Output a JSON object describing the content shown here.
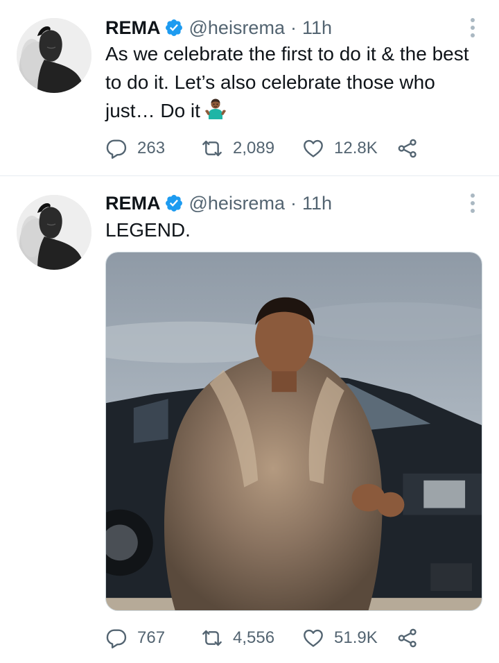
{
  "tweets": [
    {
      "author": {
        "name": "REMA",
        "handle": "@heisrema",
        "verified": true
      },
      "separator": "·",
      "time": "11h",
      "text": "As we celebrate the first to do it & the best to do it. Let’s also celebrate those who just… Do it",
      "emoji": "person-shrugging-emoji",
      "stats": {
        "replies": "263",
        "retweets": "2,089",
        "likes": "12.8K"
      },
      "has_media": false
    },
    {
      "author": {
        "name": "REMA",
        "handle": "@heisrema",
        "verified": true
      },
      "separator": "·",
      "time": "11h",
      "text": "LEGEND.",
      "stats": {
        "replies": "767",
        "retweets": "4,556",
        "likes": "51.9K"
      },
      "has_media": true,
      "media": {
        "description": "photo"
      }
    }
  ],
  "colors": {
    "verified": "#1d9bf0",
    "secondary_text": "#536471",
    "divider": "#e6ecf0",
    "icon": "#536471"
  },
  "icons": {
    "reply": "reply-icon",
    "retweet": "retweet-icon",
    "like": "heart-icon",
    "share": "share-icon",
    "more": "more-vertical-icon",
    "verified": "verified-badge-icon"
  }
}
